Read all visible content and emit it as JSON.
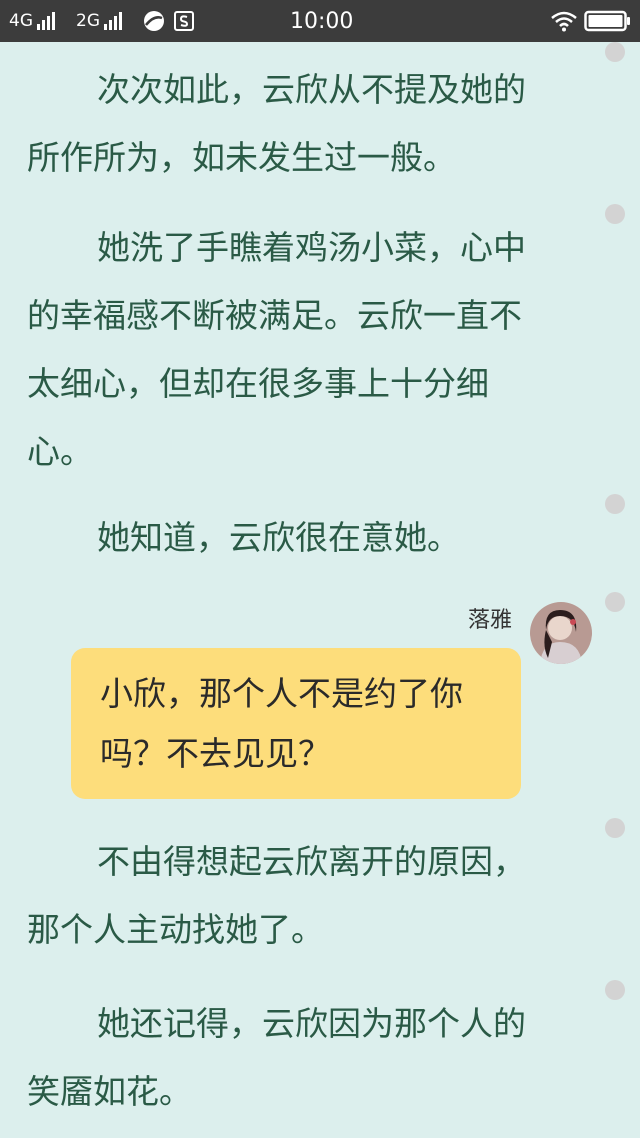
{
  "status_bar": {
    "network_1": "4G",
    "network_2": "2G",
    "time": "10:00"
  },
  "reader": {
    "paragraphs": [
      {
        "lines": [
          "次次如此，云欣从不提及她的",
          "所作所为，如未发生过一般。"
        ]
      },
      {
        "lines": [
          "她洗了手瞧着鸡汤小菜，心中",
          "的幸福感不断被满足。云欣一直不",
          "太细心，但却在很多事上十分细",
          "心。"
        ]
      },
      {
        "lines": [
          "她知道，云欣很在意她。"
        ]
      },
      {
        "lines": [
          "不由得想起云欣离开的原因，",
          "那个人主动找她了。"
        ]
      },
      {
        "lines": [
          "她还记得，云欣因为那个人的",
          "笑靥如花。"
        ]
      }
    ],
    "dialogue": {
      "speaker": "落雅",
      "lines": [
        "小欣，那个人不是约了你",
        "吗？不去见见？"
      ]
    }
  },
  "colors": {
    "background": "#dcefed",
    "text": "#2a5a46",
    "bubble": "#fddd7b",
    "status_bar": "#3c3c3c"
  }
}
